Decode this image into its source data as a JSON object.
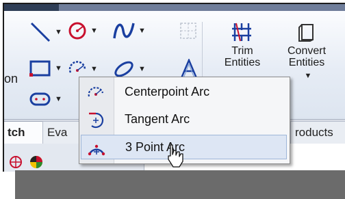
{
  "toolbar": {
    "group_label": "on",
    "trim": "Trim\nEntities",
    "convert": "Convert\nEntities",
    "colors": {
      "accent_blue": "#1a4fb0",
      "icon_red": "#c8102e"
    }
  },
  "tabs": {
    "sketch": "tch",
    "evaluate": "Eva",
    "products": "roducts"
  },
  "dropdown_menu": {
    "items": [
      {
        "label": "Centerpoint Arc",
        "icon": "centerpoint-arc-icon"
      },
      {
        "label": "Tangent Arc",
        "icon": "tangent-arc-icon"
      },
      {
        "label": "3 Point Arc",
        "icon": "3-point-arc-icon",
        "hovered": true
      }
    ]
  }
}
